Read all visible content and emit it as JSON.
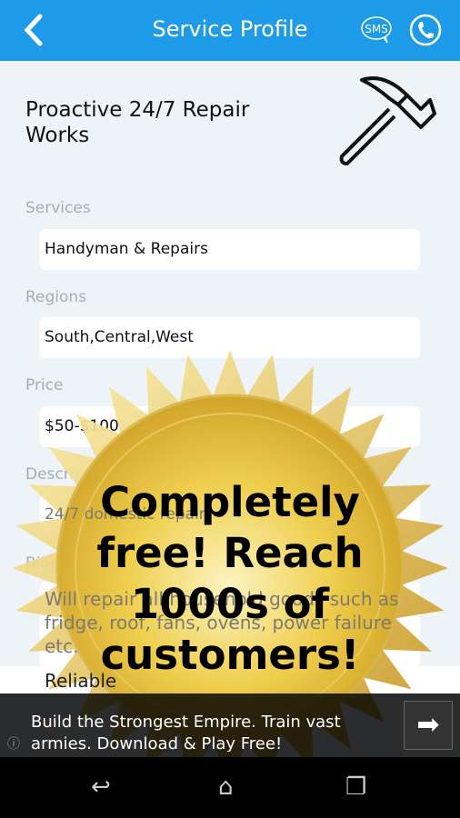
{
  "header": {
    "title": "Service Profile",
    "sms_label": "SMS",
    "colors": {
      "bar": "#1e9be8"
    }
  },
  "profile": {
    "name": "Proactive 24/7 Repair Works",
    "fields": [
      {
        "label": "Services",
        "value": "Handyman & Repairs"
      },
      {
        "label": "Regions",
        "value": "South,Central,West"
      },
      {
        "label": "Price",
        "value": "$50-$100"
      },
      {
        "label": "Description",
        "value": "24/7 domestic repair"
      }
    ],
    "biography_label": "Biography",
    "biography": "Will repair all household goods such as fridge, roof, fans, ovens, power failure etc.",
    "biography_more": "Reliable"
  },
  "promo": {
    "text": "Completely free! Reach 1000s of customers!"
  },
  "ad": {
    "text": "Build the Strongest Empire. Train vast armies. Download & Play Free!"
  },
  "icons": [
    "back-icon",
    "sms-icon",
    "phone-icon",
    "hammer-icon",
    "arrow-right-icon",
    "info-icon",
    "nav-back-icon",
    "nav-home-icon",
    "nav-recents-icon"
  ]
}
